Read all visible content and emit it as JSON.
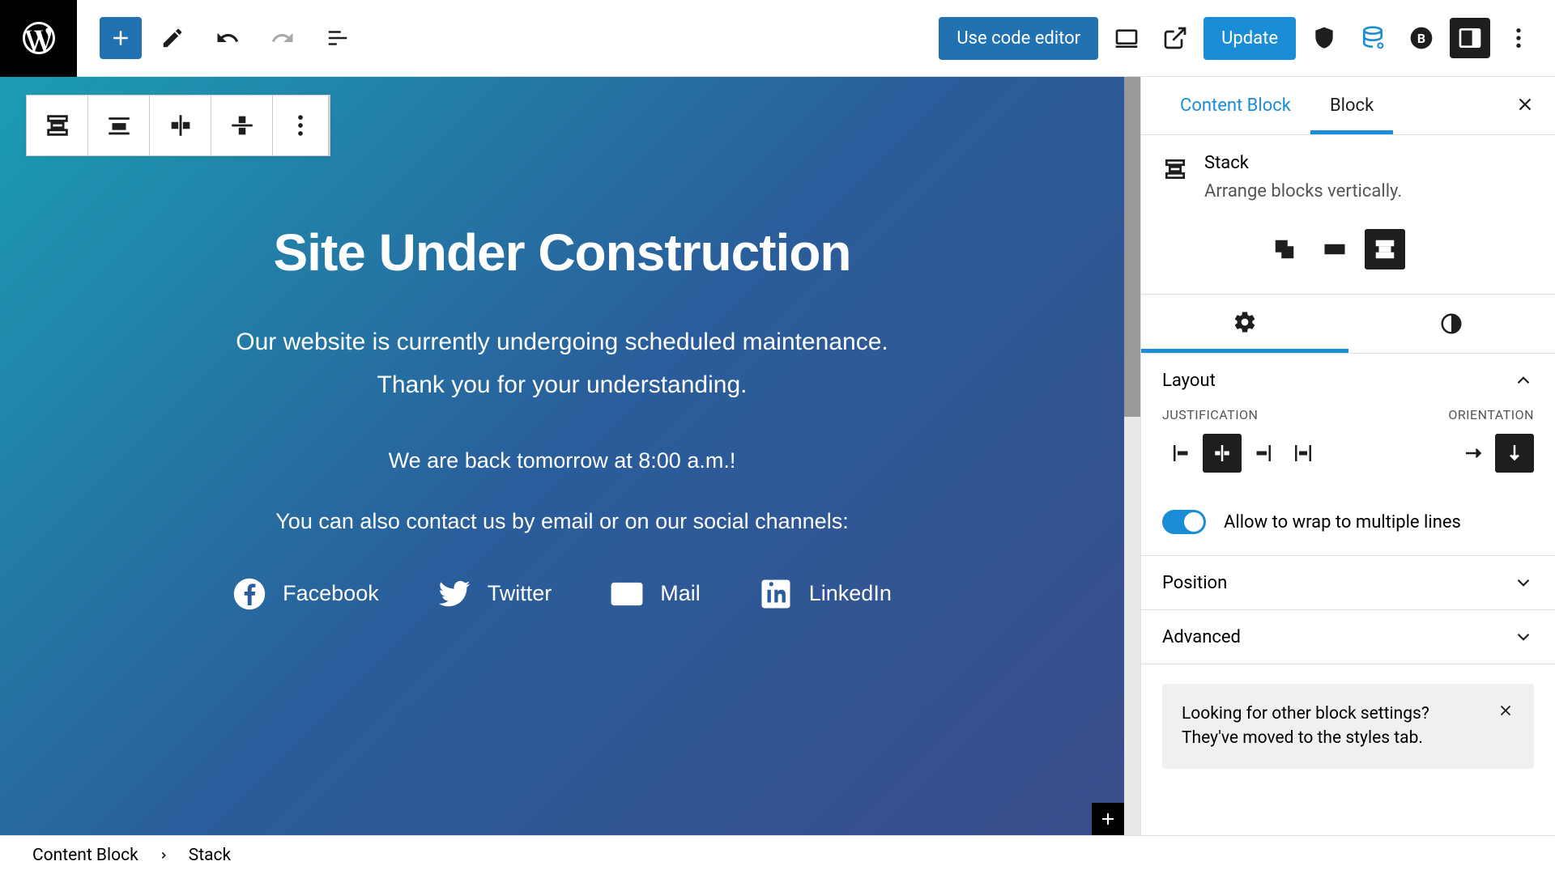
{
  "toolbar": {
    "code_editor_label": "Use code editor",
    "update_label": "Update"
  },
  "canvas": {
    "heading": "Site Under Construction",
    "line1": "Our website is currently undergoing scheduled maintenance.",
    "line2": "Thank you for your understanding.",
    "line3": "We are back tomorrow at 8:00 a.m.!",
    "line4": "You can also contact us by email or on our social channels:",
    "socials": [
      {
        "label": "Facebook"
      },
      {
        "label": "Twitter"
      },
      {
        "label": "Mail"
      },
      {
        "label": "LinkedIn"
      }
    ]
  },
  "sidebar": {
    "tab1": "Content Block",
    "tab2": "Block",
    "block_name": "Stack",
    "block_desc": "Arrange blocks vertically.",
    "layout_label": "Layout",
    "justification_label": "JUSTIFICATION",
    "orientation_label": "ORIENTATION",
    "wrap_label": "Allow to wrap to multiple lines",
    "position_label": "Position",
    "advanced_label": "Advanced",
    "info_text": "Looking for other block settings? They've moved to the styles tab."
  },
  "breadcrumb": {
    "item1": "Content Block",
    "item2": "Stack"
  }
}
